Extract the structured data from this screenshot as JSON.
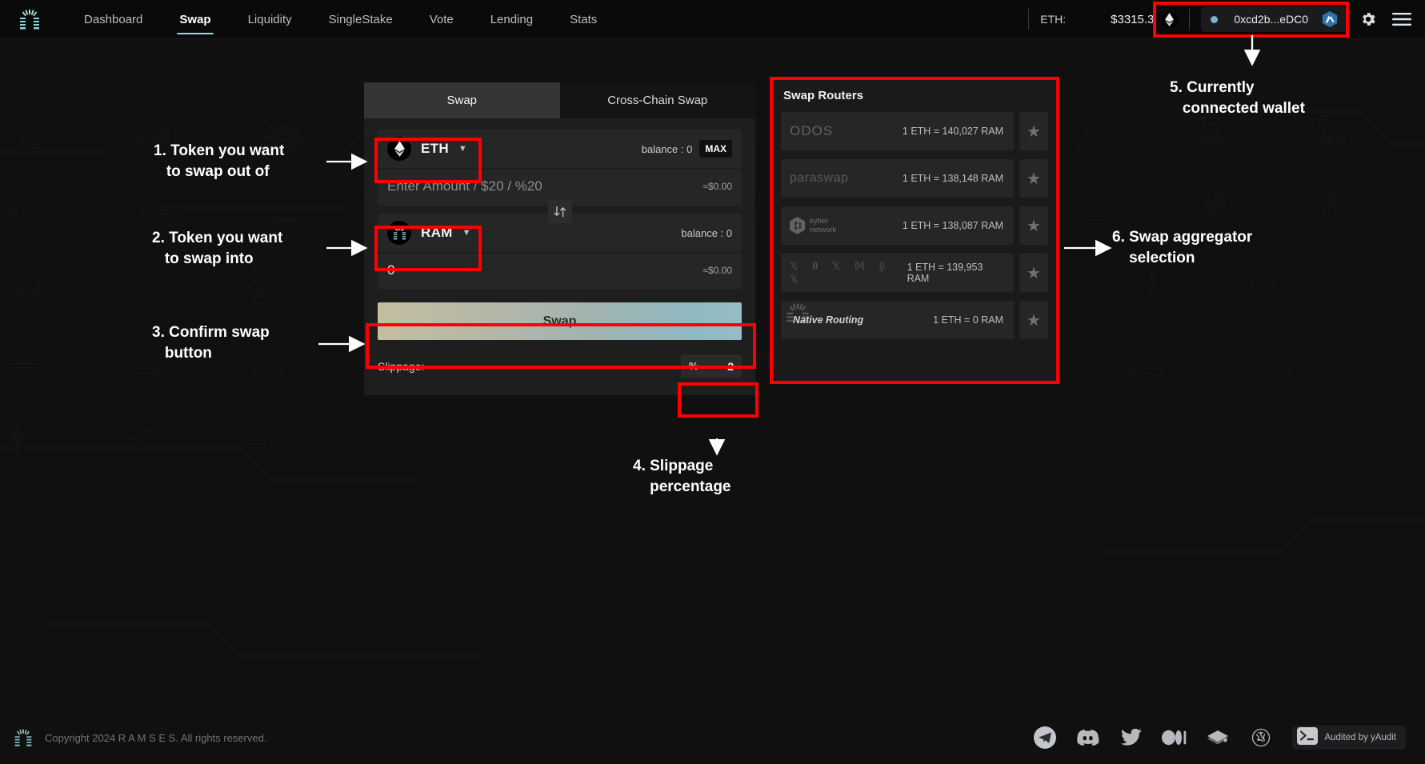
{
  "header": {
    "brand_logo_icon": "ramses-logo-icon",
    "nav": [
      {
        "label": "Dashboard",
        "active": false
      },
      {
        "label": "Swap",
        "active": true
      },
      {
        "label": "Liquidity",
        "active": false
      },
      {
        "label": "SingleStake",
        "active": false
      },
      {
        "label": "Vote",
        "active": false
      },
      {
        "label": "Lending",
        "active": false
      },
      {
        "label": "Stats",
        "active": false
      }
    ],
    "price_label": "ETH:",
    "price_value": "$3315.3",
    "eth_icon": "ethereum-icon",
    "wallet_address": "0xcd2b...eDC0",
    "wallet_icon": "arbitrum-network-icon",
    "settings_icon": "gear-icon",
    "menu_icon": "hamburger-menu-icon"
  },
  "swap": {
    "tabs": [
      {
        "label": "Swap",
        "active": true
      },
      {
        "label": "Cross-Chain Swap",
        "active": false
      }
    ],
    "from": {
      "token": "ETH",
      "token_icon": "ethereum-token-icon",
      "balance_label": "balance : 0",
      "max_label": "MAX",
      "amount_placeholder": "Enter Amount / $20 / %20",
      "amount_value": "",
      "usd_value": "≈$0.00"
    },
    "switch_icon": "swap-direction-arrows-icon",
    "to": {
      "token": "RAM",
      "token_icon": "ramses-token-icon",
      "balance_label": "balance : 0",
      "amount_value": "0",
      "usd_value": "≈$0.00"
    },
    "swap_button_label": "Swap",
    "swap_button_gradient_from": "#c2bfa0",
    "swap_button_gradient_to": "#95bcc2",
    "slippage_label": "Slippage:",
    "slippage_unit": "%",
    "slippage_value": "2"
  },
  "routers": {
    "title": "Swap Routers",
    "items": [
      {
        "name": "ODOS",
        "style": "odos",
        "rate": "1 ETH = 140,027 RAM",
        "star_icon": "star-icon"
      },
      {
        "name": "paraswap",
        "style": "paraswap",
        "rate": "1 ETH = 138,148 RAM",
        "star_icon": "star-icon"
      },
      {
        "name": "kyber network",
        "style": "kyber",
        "rate": "1 ETH = 138,087 RAM",
        "star_icon": "star-icon"
      },
      {
        "name": "0x glyphs",
        "style": "glyphs",
        "rate": "1 ETH = 139,953 RAM",
        "star_icon": "star-icon"
      },
      {
        "name": "Native Routing",
        "style": "native",
        "rate": "1 ETH = 0 RAM",
        "star_icon": "star-icon"
      }
    ]
  },
  "footer": {
    "logo_icon": "ramses-logo-icon",
    "copyright": "Copyright 2024 R A M S E S. All rights reserved.",
    "socials": [
      {
        "icon": "telegram-icon"
      },
      {
        "icon": "discord-icon"
      },
      {
        "icon": "twitter-icon"
      },
      {
        "icon": "medium-icon"
      },
      {
        "icon": "gitbook-icon"
      },
      {
        "icon": "llama-icon"
      }
    ],
    "audit_icon": "terminal-icon",
    "audit_label": "Audited by yAudit"
  },
  "annotations": {
    "color": "#ff0000",
    "items": [
      {
        "id": 1,
        "text": "1. Token you want\n   to swap out of"
      },
      {
        "id": 2,
        "text": "2. Token you want\n   to swap into"
      },
      {
        "id": 3,
        "text": "3. Confirm swap\n   button"
      },
      {
        "id": 4,
        "text": "4. Slippage\n    percentage"
      },
      {
        "id": 5,
        "text": "5. Currently\n   connected wallet"
      },
      {
        "id": 6,
        "text": "6. Swap aggregator\n    selection"
      }
    ]
  },
  "background": {
    "watermark_glyphs": "𓂀 𓃭 𓆉 𓁿 𓊝 𓋴 𓎛 𓏏 𓐍 𓂻 𓄿 𓅓 𓆑 𓇯 𓈖 𓉔 𓊪 𓌡 𓍯 𓎼 𓏤 𓐙 𓀀 𓁐 𓃒 𓄔 𓅱 𓆓 𓇳 𓈒 𓉐 𓊖 𓋹 𓌙 𓍘 𓎟 𓏛 𓐚 𓂋 𓃀 𓄂 𓅂 𓆈 𓇼 𓈗 𓉻 𓊃 𓋁 𓌶 𓍿"
  }
}
